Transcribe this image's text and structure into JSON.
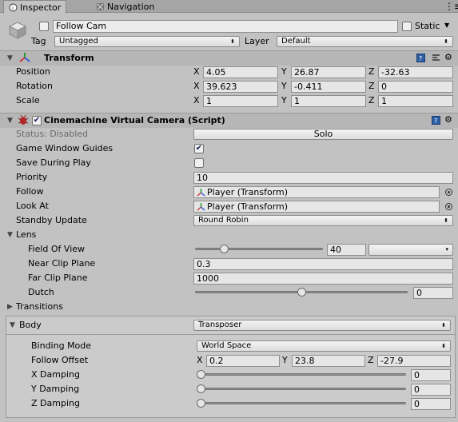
{
  "tabs": [
    {
      "label": "Inspector",
      "active": true
    },
    {
      "label": "Navigation",
      "active": false
    }
  ],
  "header": {
    "name": "Follow Cam",
    "static_label": "Static",
    "tag_label": "Tag",
    "tag_value": "Untagged",
    "layer_label": "Layer",
    "layer_value": "Default"
  },
  "transform": {
    "title": "Transform",
    "position": {
      "label": "Position",
      "x": "4.05",
      "y": "26.87",
      "z": "-32.63"
    },
    "rotation": {
      "label": "Rotation",
      "x": "39.623",
      "y": "-0.411",
      "z": "0"
    },
    "scale": {
      "label": "Scale",
      "x": "1",
      "y": "1",
      "z": "1"
    },
    "axis_x": "X",
    "axis_y": "Y",
    "axis_z": "Z"
  },
  "vcam": {
    "title": "Cinemachine Virtual Camera (Script)",
    "status": "Status: Disabled",
    "solo_label": "Solo",
    "game_window_guides": "Game Window Guides",
    "save_during_play": "Save During Play",
    "priority_label": "Priority",
    "priority_value": "10",
    "follow_label": "Follow",
    "follow_value": "Player (Transform)",
    "look_at_label": "Look At",
    "look_at_value": "Player (Transform)",
    "standby_label": "Standby Update",
    "standby_value": "Round Robin",
    "lens_label": "Lens",
    "fov_label": "Field Of View",
    "fov_value": "40",
    "near_label": "Near Clip Plane",
    "near_value": "0.3",
    "far_label": "Far Clip Plane",
    "far_value": "1000",
    "dutch_label": "Dutch",
    "dutch_value": "0",
    "transitions_label": "Transitions"
  },
  "body": {
    "label": "Body",
    "value": "Transposer",
    "binding_label": "Binding Mode",
    "binding_value": "World Space",
    "offset_label": "Follow Offset",
    "offset_x": "0.2",
    "offset_y": "23.8",
    "offset_z": "-27.9",
    "x_damp_label": "X Damping",
    "x_damp_value": "0",
    "y_damp_label": "Y Damping",
    "y_damp_value": "0",
    "z_damp_label": "Z Damping",
    "z_damp_value": "0"
  },
  "levels": {
    "fov_slider": 0.21,
    "dutch_slider": 0.5,
    "x_damp_slider": 0,
    "y_damp_slider": 0,
    "z_damp_slider": 0
  },
  "icons": [
    "inspector-icon",
    "navigation-icon",
    "gameobject-cube-icon",
    "transform-axes-icon",
    "help-icon",
    "layout-icon",
    "gear-icon",
    "script-bug-icon",
    "object-picker-icon"
  ],
  "colors": {
    "background": "#c2c2c2",
    "tabbar": "#a5a5a5",
    "checkmark": "#14205a"
  }
}
